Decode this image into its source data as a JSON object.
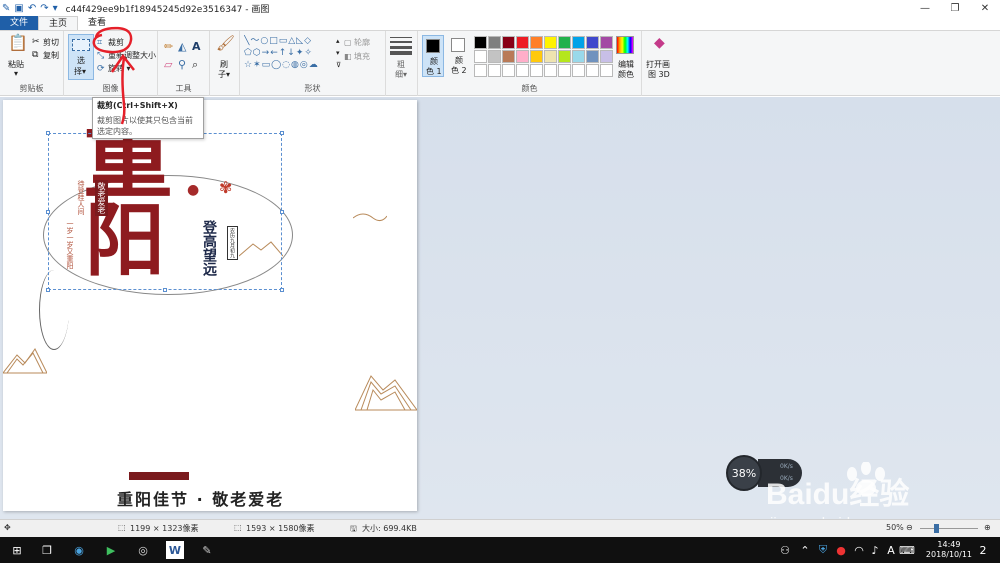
{
  "window": {
    "title": "c44f429ee9b1f18945245d92e3516347 - 画图",
    "minimize": "—",
    "maximize": "❐",
    "close": "✕"
  },
  "tabs": [
    {
      "label": "文件"
    },
    {
      "label": "主页"
    },
    {
      "label": "查看"
    }
  ],
  "ribbon": {
    "clipboard": {
      "paste": "粘贴",
      "cut": "剪切",
      "copy": "复制",
      "group": "剪贴板"
    },
    "image": {
      "select_line1": "选",
      "select_line2": "择",
      "crop": "裁剪",
      "resize": "重新调整大小",
      "rotate": "旋转",
      "group": "图像"
    },
    "tools": {
      "group": "工具"
    },
    "brush": {
      "line1": "刷",
      "line2": "子"
    },
    "shapes": {
      "outline": "轮廓",
      "fill": "填充",
      "group": "形状"
    },
    "size": {
      "line1": "粗",
      "line2": "细"
    },
    "colors": {
      "color1_line1": "颜",
      "color1_line2": "色 1",
      "color2_line1": "颜",
      "color2_line2": "色 2",
      "edit_line1": "编辑",
      "edit_line2": "颜色",
      "group": "颜色"
    },
    "paint3d": {
      "line1": "打开画",
      "line2": "图 3D"
    }
  },
  "palette": [
    "#000000",
    "#7f7f7f",
    "#880015",
    "#ed1c24",
    "#ff7f27",
    "#fff200",
    "#22b14c",
    "#00a2e8",
    "#3f48cc",
    "#a349a4",
    "#ffffff",
    "#c3c3c3",
    "#b97a57",
    "#ffaec9",
    "#ffc90e",
    "#efe4b0",
    "#b5e61d",
    "#99d9ea",
    "#7092be",
    "#c8bfe7",
    "#ffffff",
    "#ffffff",
    "#ffffff",
    "#ffffff",
    "#ffffff",
    "#ffffff",
    "#ffffff",
    "#ffffff",
    "#ffffff",
    "#ffffff"
  ],
  "tooltip": {
    "title": "裁剪(Ctrl+Shift+X)",
    "desc": "裁剪图片以使其只包含当前选定内容。"
  },
  "canvas": {
    "big1": "重",
    "big2": "阳",
    "v1": "登高望远",
    "v2": "敬老爱老",
    "v3": "待登桂人间",
    "v4": "一岁一岁又重阳",
    "v5": "农历九月初九",
    "slogan": "重阳佳节 · 敬老爱老"
  },
  "statusbar": {
    "selection_size": "1199 × 1323像素",
    "image_size": "1593 × 1580像素",
    "file_size": "大小: 699.4KB",
    "zoom": "50%"
  },
  "netwidget": {
    "percent": "38%",
    "up": "0K/s",
    "down": "0K/s"
  },
  "watermark": {
    "brand": "Baidu经验",
    "url": "jingyan.baidu.com"
  },
  "taskbar": {
    "time": "14:49",
    "date": "2018/10/11",
    "ime": "A",
    "notif": "2"
  }
}
